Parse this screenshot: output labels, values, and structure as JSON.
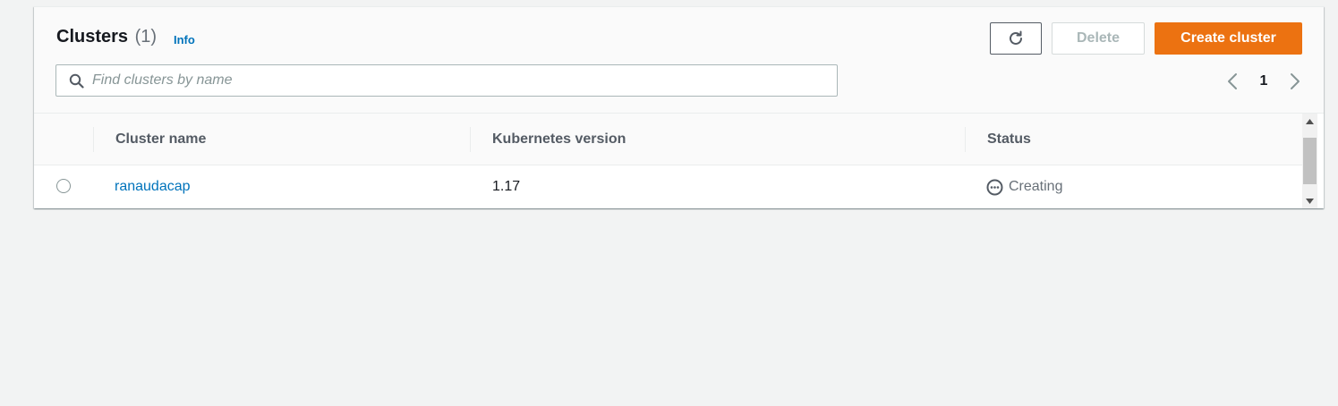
{
  "header": {
    "title": "Clusters",
    "count": "(1)",
    "info_label": "Info"
  },
  "toolbar": {
    "refresh_icon": "refresh-icon",
    "delete_label": "Delete",
    "create_label": "Create cluster"
  },
  "search": {
    "placeholder": "Find clusters by name",
    "value": ""
  },
  "pagination": {
    "current_page": "1"
  },
  "table": {
    "columns": [
      "Cluster name",
      "Kubernetes version",
      "Status"
    ],
    "rows": [
      {
        "name": "ranaudacap",
        "version": "1.17",
        "status": "Creating",
        "status_icon": "pending-icon"
      }
    ]
  },
  "colors": {
    "primary_button": "#ec7211",
    "link": "#0073bb",
    "background": "#f2f3f3"
  }
}
